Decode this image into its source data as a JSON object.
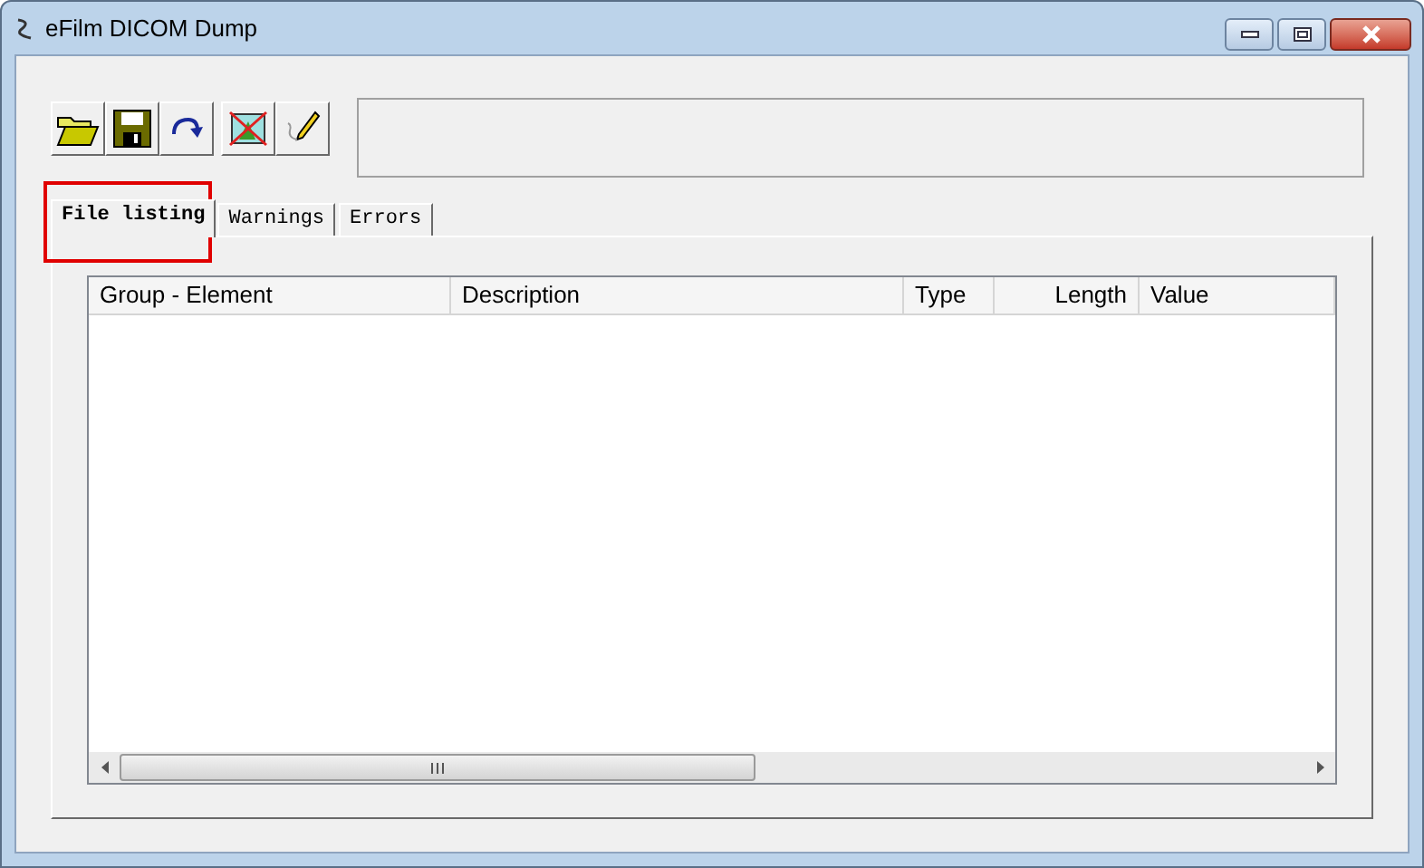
{
  "window": {
    "title": "eFilm DICOM Dump"
  },
  "tabs": [
    {
      "label": "File listing",
      "selected": true
    },
    {
      "label": "Warnings",
      "selected": false
    },
    {
      "label": "Errors",
      "selected": false
    }
  ],
  "table": {
    "columns": [
      {
        "label": "Group - Element",
        "kind": "text"
      },
      {
        "label": "Description",
        "kind": "text"
      },
      {
        "label": "Type",
        "kind": "text"
      },
      {
        "label": "Length",
        "kind": "number"
      },
      {
        "label": "Value",
        "kind": "text"
      }
    ]
  }
}
